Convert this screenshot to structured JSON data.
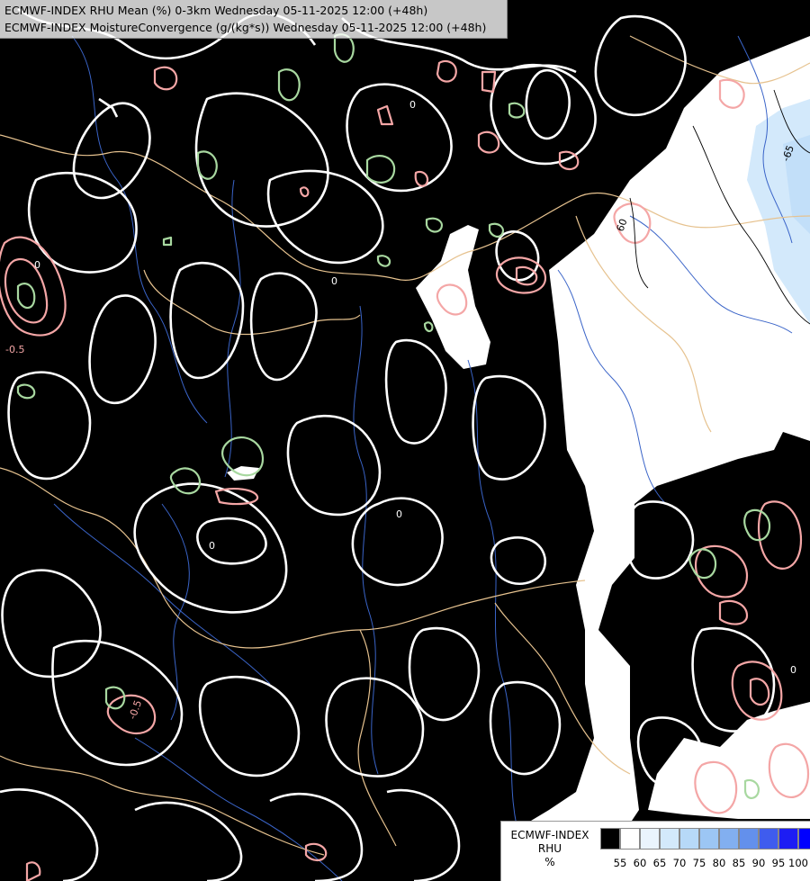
{
  "title": {
    "line1": "ECMWF-INDEX RHU Mean (%) 0-3km Wednesday 05-11-2025 12:00 (+48h)",
    "line2": "ECMWF-INDEX MoistureConvergence (g/(kg*s)) Wednesday 05-11-2025 12:00 (+48h)"
  },
  "legend": {
    "label_line1": "ECMWF-INDEX",
    "label_line2": "RHU",
    "unit": "%",
    "ticks": [
      "55",
      "60",
      "65",
      "70",
      "75",
      "80",
      "85",
      "90",
      "95",
      "100"
    ],
    "colors": [
      "#000000",
      "#ffffff",
      "#eaf4fd",
      "#d3e9fb",
      "#b7d9f8",
      "#9cc6f4",
      "#82aff0",
      "#6390ec",
      "#3f5cee",
      "#1d1df4",
      "#0000ff"
    ]
  },
  "contour_labels": [
    {
      "text": "0",
      "kind": "convergence"
    },
    {
      "text": "0",
      "kind": "convergence"
    },
    {
      "text": "-0.5",
      "kind": "divergence"
    },
    {
      "text": "-0.5",
      "kind": "divergence"
    },
    {
      "text": "0",
      "kind": "convergence"
    },
    {
      "text": "0",
      "kind": "convergence"
    },
    {
      "text": "60",
      "kind": "rhu"
    },
    {
      "text": "-65",
      "kind": "rhu"
    },
    {
      "text": "0",
      "kind": "convergence"
    },
    {
      "text": "0",
      "kind": "convergence"
    }
  ],
  "style": {
    "background": "#000000",
    "zero_contour": "#ffffff",
    "negative_contour": "#f4a6a6",
    "positive_contour": "#a8d8a0",
    "border": "#e6c28f",
    "river": "#3a64c8"
  }
}
